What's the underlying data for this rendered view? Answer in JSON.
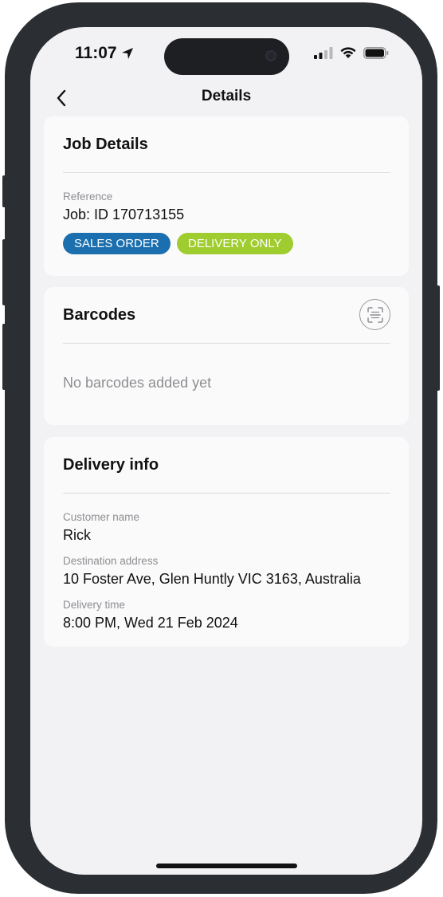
{
  "status_bar": {
    "time": "11:07"
  },
  "nav": {
    "title": "Details"
  },
  "job_details": {
    "title": "Job Details",
    "reference_label": "Reference",
    "reference_value": "Job: ID 170713155",
    "tags": [
      {
        "label": "SALES ORDER",
        "color": "#1b6fae"
      },
      {
        "label": "DELIVERY ONLY",
        "color": "#9fcc2e"
      }
    ]
  },
  "barcodes": {
    "title": "Barcodes",
    "empty_text": "No barcodes added yet"
  },
  "delivery_info": {
    "title": "Delivery info",
    "customer_label": "Customer name",
    "customer_value": "Rick",
    "address_label": "Destination address",
    "address_value": "10 Foster Ave, Glen Huntly VIC 3163, Australia",
    "time_label": "Delivery time",
    "time_value": "8:00 PM, Wed 21 Feb 2024"
  },
  "colors": {
    "screen_bg": "#f2f2f4",
    "card_bg": "#fafafa",
    "frame": "#2b2e33"
  }
}
